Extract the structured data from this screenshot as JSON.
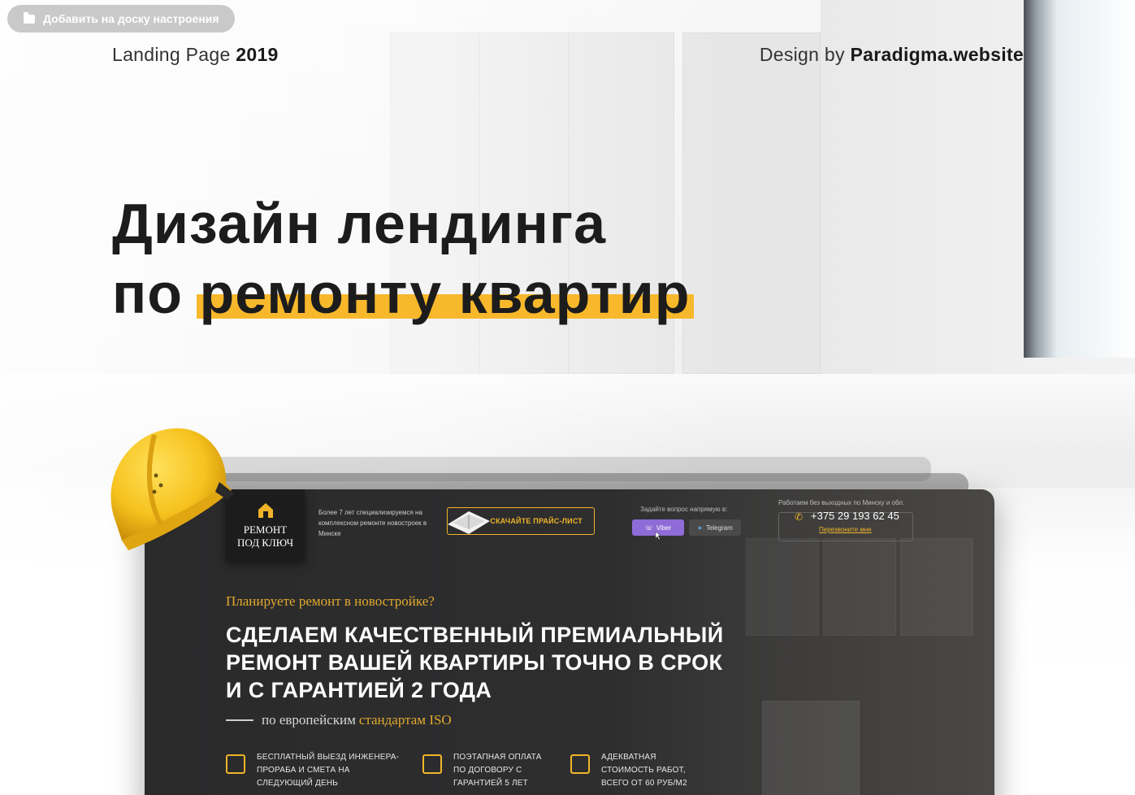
{
  "board_button": {
    "label": "Добавить на доску настроения",
    "icon": "folder-icon"
  },
  "meta": {
    "left_prefix": "Landing Page",
    "left_year": "2019",
    "right_prefix": "Design by",
    "right_brand": "Paradigma.website"
  },
  "headline": {
    "line1": "Дизайн лендинга",
    "line2_start": "по",
    "line2_highlight": "ремонту квартир",
    "accent_color": "#f8b82c"
  },
  "mockup": {
    "logo": {
      "line1": "РЕМОНТ",
      "line2": "ПОД КЛЮЧ"
    },
    "intro_text": "Более 7 лет специализируемся на комплексном ремонте новостроек в Минске",
    "price_button": "СКАЧАЙТЕ ПРАЙС-ЛИСТ",
    "ask_label": "Задайте вопрос напрямую в:",
    "viber": "Viber",
    "telegram": "Telegram",
    "work_label": "Работаем без выходных по Минску и обл.",
    "phone": "+375 29 193 62 45",
    "callback": "Перезвоните мне",
    "question": "Планируете ремонт в новостройке?",
    "title_line1": "СДЕЛАЕМ КАЧЕСТВЕННЫЙ ПРЕМИАЛЬНЫЙ",
    "title_line2": "РЕМОНТ ВАШЕЙ КВАРТИРЫ ТОЧНО В СРОК",
    "title_line3": "И С ГАРАНТИЕЙ 2 ГОДА",
    "iso_prefix": "по европейским",
    "iso_highlight": "стандартам ISO",
    "features": [
      {
        "icon": "truck-icon",
        "lines": [
          "БЕСПЛАТНЫЙ ВЫЕЗД ИНЖЕНЕРА-",
          "ПРОРАБА И СМЕТА НА",
          "СЛЕДУЮЩИЙ ДЕНЬ"
        ]
      },
      {
        "icon": "contract-icon",
        "lines": [
          "ПОЭТАПНАЯ ОПЛАТА",
          "ПО ДОГОВОРУ С",
          "ГАРАНТИЕЙ 5 ЛЕТ"
        ]
      },
      {
        "icon": "wallet-icon",
        "lines": [
          "АДЕКВАТНАЯ",
          "СТОИМОСТЬ РАБОТ,",
          "ВСЕГО ОТ 60 РУБ/М2"
        ]
      }
    ],
    "accent_color": "#f0b429"
  }
}
